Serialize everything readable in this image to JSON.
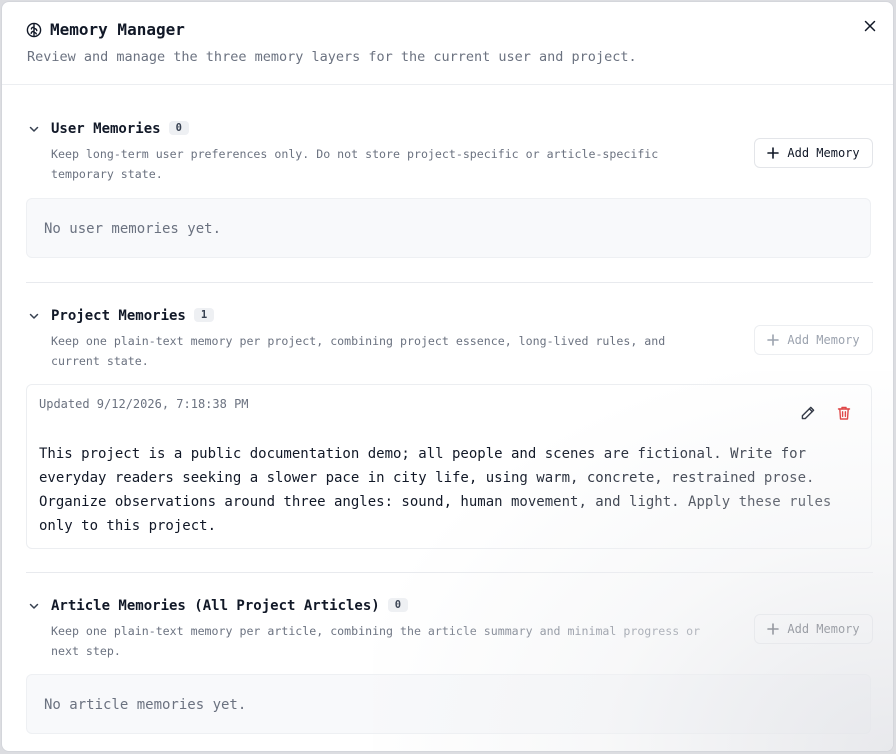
{
  "dialog": {
    "title": "Memory Manager",
    "subtitle": "Review and manage the three memory layers for the current user and project.",
    "title_icon": "brain-icon",
    "close_icon": "close-icon"
  },
  "sections": {
    "user": {
      "title": "User Memories",
      "count": "0",
      "description": "Keep long-term user preferences only. Do not store project-specific or article-specific temporary state.",
      "add_label": "Add Memory",
      "empty_text": "No user memories yet."
    },
    "project": {
      "title": "Project Memories",
      "count": "1",
      "description": "Keep one plain-text memory per project, combining project essence, long-lived rules, and current state.",
      "add_label": "Add Memory",
      "add_disabled": true,
      "memory": {
        "updated": "Updated 9/12/2026, 7:18:38 PM",
        "content": "This project is a public documentation demo; all people and scenes are fictional. Write for everyday readers seeking a slower pace in city life, using warm, concrete, restrained prose. Organize observations around three angles: sound, human movement, and light. Apply these rules only to this project.",
        "edit_icon": "pencil-icon",
        "delete_icon": "trash-icon"
      }
    },
    "article": {
      "title": "Article Memories (All Project Articles)",
      "count": "0",
      "description": "Keep one plain-text memory per article, combining the article summary and minimal progress or next step.",
      "add_label": "Add Memory",
      "empty_text": "No article memories yet."
    }
  },
  "colors": {
    "text": "#111827",
    "muted": "#6b7280",
    "danger": "#dc2626",
    "border": "#e3e5e9"
  }
}
